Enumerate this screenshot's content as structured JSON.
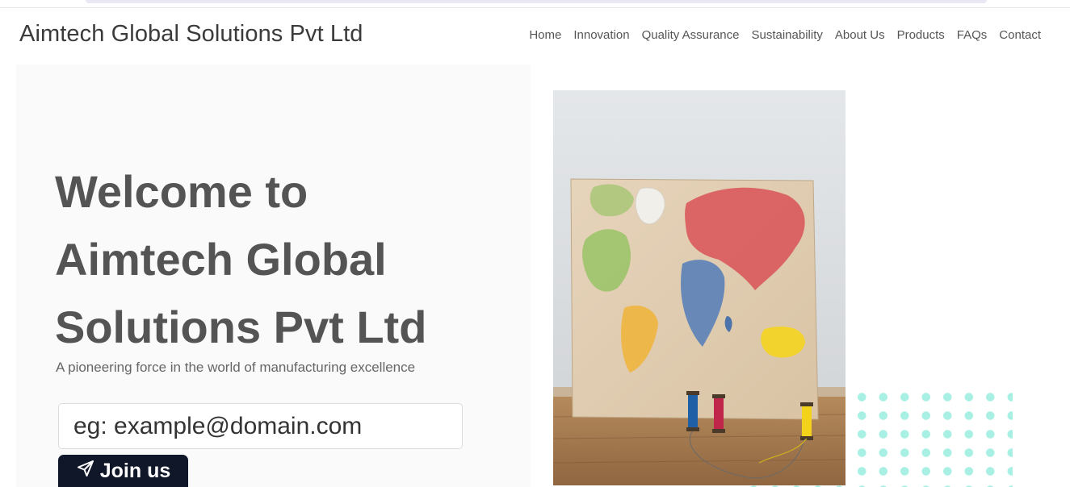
{
  "brand": "Aimtech Global Solutions Pvt Ltd",
  "nav": {
    "items": [
      {
        "label": "Home"
      },
      {
        "label": "Innovation"
      },
      {
        "label": "Quality Assurance"
      },
      {
        "label": "Sustainability"
      },
      {
        "label": "About Us"
      },
      {
        "label": "Products"
      },
      {
        "label": "FAQs"
      },
      {
        "label": "Contact"
      }
    ]
  },
  "hero": {
    "title": "Welcome to Aimtech Global Solutions Pvt Ltd",
    "subtitle": "A pioneering force in the world of manufacturing excellence",
    "email_placeholder": "eg: example@domain.com",
    "join_label": "Join us",
    "join_icon": "send-icon"
  },
  "colors": {
    "button_bg": "#0f1729",
    "accent_dots": "#a9f0e4",
    "panel_bg": "#fafafa"
  }
}
